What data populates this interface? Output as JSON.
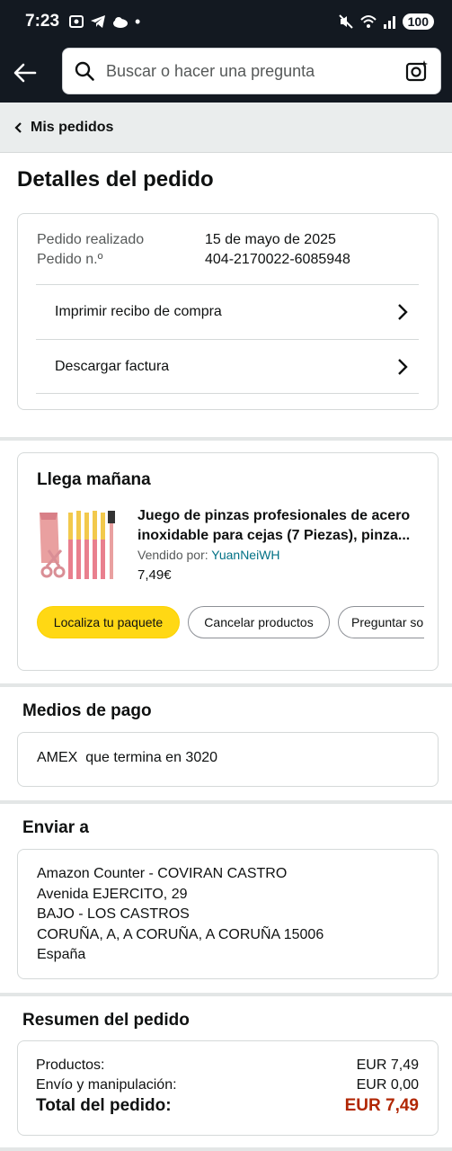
{
  "status": {
    "time": "7:23",
    "battery": "100"
  },
  "search": {
    "placeholder": "Buscar o hacer una pregunta"
  },
  "breadcrumb": {
    "label": "Mis pedidos"
  },
  "page": {
    "title": "Detalles del pedido"
  },
  "order_info": {
    "placed_label": "Pedido realizado",
    "placed_value": "15 de mayo de 2025",
    "number_label": "Pedido n.º",
    "number_value": "404-2170022-6085948",
    "print_label": "Imprimir recibo de compra",
    "invoice_label": "Descargar factura"
  },
  "shipment": {
    "title": "Llega mañana",
    "product_title": "Juego de pinzas profesionales de acero inoxidable para cejas (7 Piezas), pinza...",
    "sold_by_label": "Vendido por:",
    "seller": "YuanNeiWH",
    "price": "7,49€",
    "btn_track": "Localiza tu paquete",
    "btn_cancel": "Cancelar productos",
    "btn_ask": "Preguntar so"
  },
  "payment": {
    "title": "Medios de pago",
    "method": "AMEX  que termina en 3020"
  },
  "shipping": {
    "title": "Enviar a",
    "lines": [
      "Amazon Counter - COVIRAN CASTRO",
      "Avenida EJERCITO, 29",
      "BAJO - LOS CASTROS",
      "CORUÑA, A, A CORUÑA, A CORUÑA 15006",
      "España"
    ]
  },
  "summary": {
    "title": "Resumen del pedido",
    "products_label": "Productos:",
    "products_value": "EUR 7,49",
    "shipping_label": "Envío y manipulación:",
    "shipping_value": "EUR 0,00",
    "total_label": "Total del pedido:",
    "total_value": "EUR 7,49"
  },
  "colors": {
    "header": "#131921",
    "accent_yellow": "#ffd814",
    "total_red": "#b12704",
    "link_blue": "#007185"
  }
}
